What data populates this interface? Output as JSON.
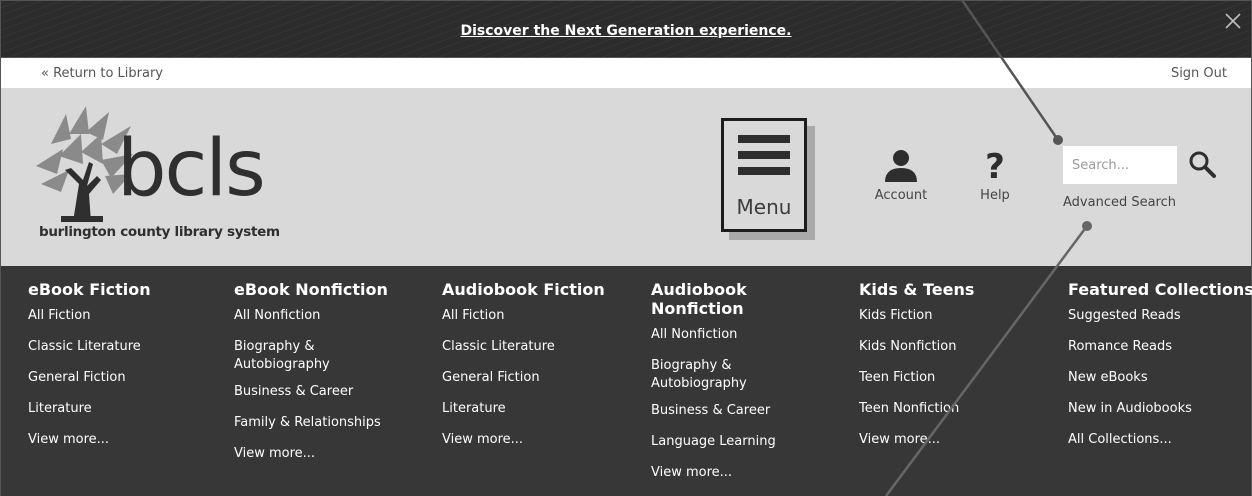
{
  "banner": {
    "link_text": "Discover the Next Generation experience."
  },
  "util": {
    "return_label": "« Return to Library",
    "signout_label": "Sign Out"
  },
  "logo": {
    "wordmark": "bcls",
    "tagline": "burlington county library system"
  },
  "header": {
    "menu_label": "Menu",
    "account_label": "Account",
    "help_label": "Help",
    "search_placeholder": "Search...",
    "advanced_search_label": "Advanced Search"
  },
  "nav": {
    "columns": [
      {
        "title": "eBook Fiction",
        "links": [
          "All Fiction",
          "Classic Literature",
          "General Fiction",
          "Literature",
          "View more..."
        ]
      },
      {
        "title": "eBook Nonfiction",
        "links": [
          "All Nonfiction",
          "Biography & Autobiography",
          "Business & Career",
          "Family & Relationships",
          "View more..."
        ]
      },
      {
        "title": "Audiobook Fiction",
        "links": [
          "All Fiction",
          "Classic Literature",
          "General Fiction",
          "Literature",
          "View more..."
        ]
      },
      {
        "title": "Audiobook Nonfiction",
        "links": [
          "All Nonfiction",
          "Biography & Autobiography",
          "Business & Career",
          "Language Learning",
          "View more..."
        ]
      },
      {
        "title": "Kids & Teens",
        "links": [
          "Kids Fiction",
          "Kids Nonfiction",
          "Teen Fiction",
          "Teen Nonfiction",
          "View more..."
        ]
      },
      {
        "title": "Featured Collections",
        "links": [
          "Suggested Reads",
          "Romance Reads",
          "New eBooks",
          "New in Audiobooks",
          "All Collections..."
        ]
      }
    ]
  },
  "colors": {
    "banner_bg": "#2c2c2c",
    "header_bg": "#d9d9d9",
    "nav_bg": "#373737",
    "text_light": "#ffffff"
  },
  "icons": {
    "close": "close-icon",
    "account": "person-icon",
    "help": "question-mark-icon",
    "search": "magnifier-icon",
    "menu": "hamburger-icon"
  }
}
